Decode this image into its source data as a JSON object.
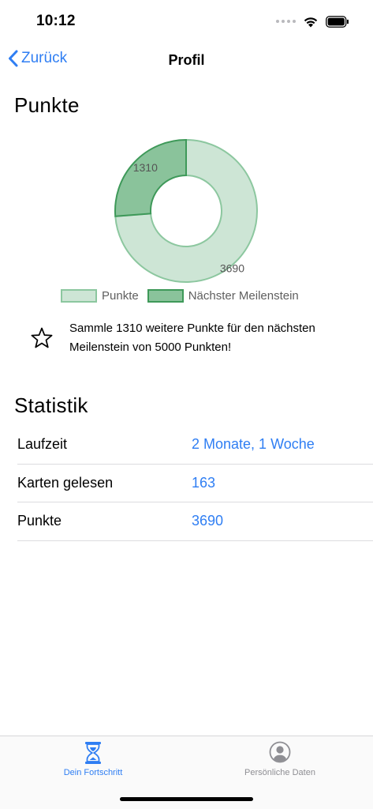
{
  "status_bar": {
    "time": "10:12"
  },
  "nav": {
    "back_label": "Zurück",
    "title": "Profil"
  },
  "points_section": {
    "title": "Punkte"
  },
  "chart_data": {
    "type": "pie",
    "style": "doughnut",
    "series": [
      {
        "name": "Punkte",
        "value": 3690,
        "color": "#cde5d5",
        "border": "#8cc79f"
      },
      {
        "name": "Nächster Meilenstein",
        "value": 1310,
        "color": "#8ac39b",
        "border": "#3e9959"
      }
    ],
    "labels": [
      "3690",
      "1310"
    ],
    "legend": [
      "Punkte",
      "Nächster Meilenstein"
    ],
    "legend_position": "bottom",
    "title": ""
  },
  "milestone": {
    "icon": "star-icon",
    "text": "Sammle 1310 weitere Punkte für den nächsten Meilenstein von 5000 Punkten!"
  },
  "stats_section": {
    "title": "Statistik",
    "rows": [
      {
        "label": "Laufzeit",
        "value": "2 Monate, 1 Woche"
      },
      {
        "label": "Karten gelesen",
        "value": "163"
      },
      {
        "label": "Punkte",
        "value": "3690"
      }
    ]
  },
  "tab_bar": {
    "tabs": [
      {
        "label": "Dein Fortschritt",
        "icon": "hourglass-icon",
        "active": true
      },
      {
        "label": "Persönliche Daten",
        "icon": "person-circle-icon",
        "active": false
      }
    ]
  },
  "colors": {
    "accent": "#2f7ef3",
    "inactive": "#8e8e93"
  }
}
